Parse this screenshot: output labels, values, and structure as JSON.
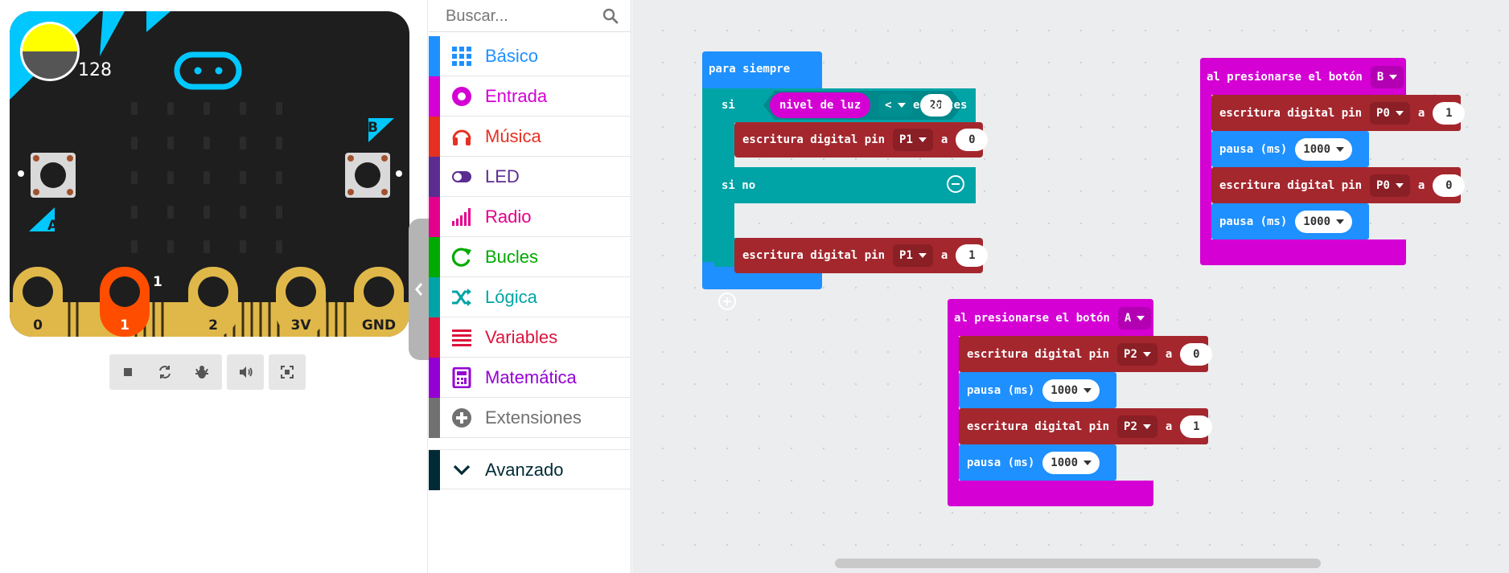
{
  "simulator": {
    "light_level": "128",
    "pin_value": "1",
    "buttons": {
      "a": "A",
      "b": "B"
    },
    "pins": [
      "0",
      "1",
      "2",
      "3V",
      "GND"
    ],
    "controls": [
      "stop-icon",
      "restart-icon",
      "debug-icon",
      "sound-icon",
      "fullscreen-icon"
    ]
  },
  "toolbox": {
    "search_placeholder": "Buscar...",
    "categories": [
      {
        "label": "Básico",
        "color": "#1e90ff",
        "icon": "grid-icon"
      },
      {
        "label": "Entrada",
        "color": "#d400d4",
        "icon": "circle-dot-icon"
      },
      {
        "label": "Música",
        "color": "#e63022",
        "icon": "headphones-icon"
      },
      {
        "label": "LED",
        "color": "#5c2d91",
        "icon": "toggle-icon"
      },
      {
        "label": "Radio",
        "color": "#e3008c",
        "icon": "signal-bars-icon"
      },
      {
        "label": "Bucles",
        "color": "#00aa00",
        "icon": "refresh-icon"
      },
      {
        "label": "Lógica",
        "color": "#00a4a6",
        "icon": "shuffle-icon"
      },
      {
        "label": "Variables",
        "color": "#dc143c",
        "icon": "list-icon"
      },
      {
        "label": "Matemática",
        "color": "#9400d3",
        "icon": "calculator-icon"
      },
      {
        "label": "Extensiones",
        "color": "#717171",
        "icon": "plus-circle-icon"
      }
    ],
    "advanced": {
      "label": "Avanzado",
      "color": "#002b36",
      "icon": "chevron-down-icon"
    }
  },
  "blocks": {
    "forever": {
      "label": "para siempre",
      "if_label": "si",
      "light_reporter": "nivel de luz",
      "operator": "<",
      "threshold": "20",
      "then_label": "entonces",
      "write1": {
        "label": "escritura digital pin",
        "pin": "P1",
        "to": "a",
        "value": "0"
      },
      "else_label": "si no",
      "write2": {
        "label": "escritura digital pin",
        "pin": "P1",
        "to": "a",
        "value": "1"
      }
    },
    "button_b": {
      "label": "al presionarse el botón",
      "button": "B",
      "write1": {
        "label": "escritura digital pin",
        "pin": "P0",
        "to": "a",
        "value": "1"
      },
      "pause1": {
        "label": "pausa (ms)",
        "value": "1000"
      },
      "write2": {
        "label": "escritura digital pin",
        "pin": "P0",
        "to": "a",
        "value": "0"
      },
      "pause2": {
        "label": "pausa (ms)",
        "value": "1000"
      }
    },
    "button_a": {
      "label": "al presionarse el botón",
      "button": "A",
      "write1": {
        "label": "escritura digital pin",
        "pin": "P2",
        "to": "a",
        "value": "0"
      },
      "pause1": {
        "label": "pausa (ms)",
        "value": "1000"
      },
      "write2": {
        "label": "escritura digital pin",
        "pin": "P2",
        "to": "a",
        "value": "1"
      },
      "pause2": {
        "label": "pausa (ms)",
        "value": "1000"
      }
    }
  },
  "colors": {
    "basic": "#1e90ff",
    "input": "#d400d4",
    "logic": "#00a4a6",
    "pins": "#a4272e",
    "board": "#1e1e1e",
    "accent": "#00c8ff",
    "gold": "#e0b84a",
    "pin_active": "#ff4d00"
  }
}
